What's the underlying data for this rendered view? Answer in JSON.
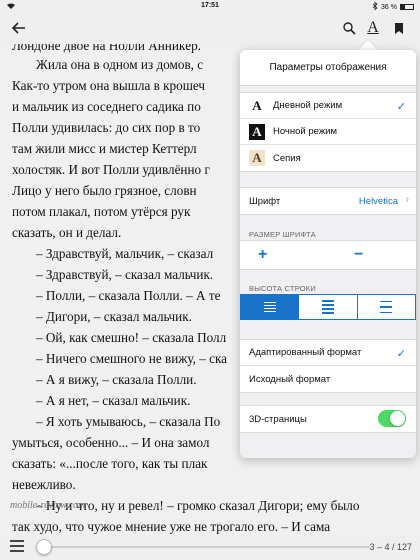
{
  "status_bar": {
    "time": "17:51",
    "battery": "36 %",
    "icons": [
      "wifi-icon",
      "bluetooth-icon",
      "battery-icon"
    ]
  },
  "toolbar": {
    "back_icon": "back-arrow-icon",
    "search_icon": "search-icon",
    "font_icon": "A",
    "bookmark_icon": "bookmark-icon"
  },
  "reading": {
    "lines": [
      "Лондоне двое на Нолли Анникёр.",
      "Жила она в одном из домов, с",
      "Как-то утром она вышла в крошеч",
      "и мальчик из соседнего садика по",
      "Полли удивилась: до сих пор в то",
      "там жили мисс и мистер Кеттерл",
      "холостяк. И вот Полли удивлённо г",
      "Лицо у него было грязное, словн",
      "потом плакал, потом утёрся рук",
      "сказать, он и делал.",
      "– Здравствуй, мальчик, – сказал",
      "– Здравствуй, – сказал мальчик.",
      "– Полли, – сказала Полли. – А те",
      "– Дигори, – сказал мальчик.",
      "– Ой, как смешно! – сказала Полл",
      "– Ничего смешного не вижу, – ска",
      "– А я вижу, – сказала Полли.",
      "– А я нет, – сказал мальчик.",
      "– Я хоть умываюсь, – сказала По",
      "умыться, особенно... – И она замол",
      "сказать: «...после того, как ты плак",
      "невежливо.",
      "– Ну и что, ну и ревел! – громко сказал Дигори; ему было",
      "так худо, что чужое мнение уже не трогало его. – И сама"
    ],
    "watermark": "mobile-review.com"
  },
  "popover": {
    "title": "Параметры отображения",
    "modes": [
      {
        "icon": "A",
        "label": "Дневной режим",
        "selected": true
      },
      {
        "icon": "A",
        "label": "Ночной режим",
        "selected": false
      },
      {
        "icon": "A",
        "label": "Сепия",
        "selected": false
      }
    ],
    "font_label": "Шрифт",
    "font_value": "Helvetica",
    "size_section_label": "РАЗМЕР ШРИФТА",
    "size_increase": "+",
    "size_decrease": "−",
    "spacing_section_label": "ВЫСОТА СТРОКИ",
    "spacing_selected": "tight",
    "format_adaptive": "Адаптированный формат",
    "format_original": "Исходный формат",
    "format_selected": "adaptive",
    "pages_3d_label": "3D-страницы",
    "pages_3d_enabled": true
  },
  "bottom_bar": {
    "page_indicator": "3 – 4 / 127",
    "progress": 0.02,
    "accent_color": "#1a73c8"
  }
}
